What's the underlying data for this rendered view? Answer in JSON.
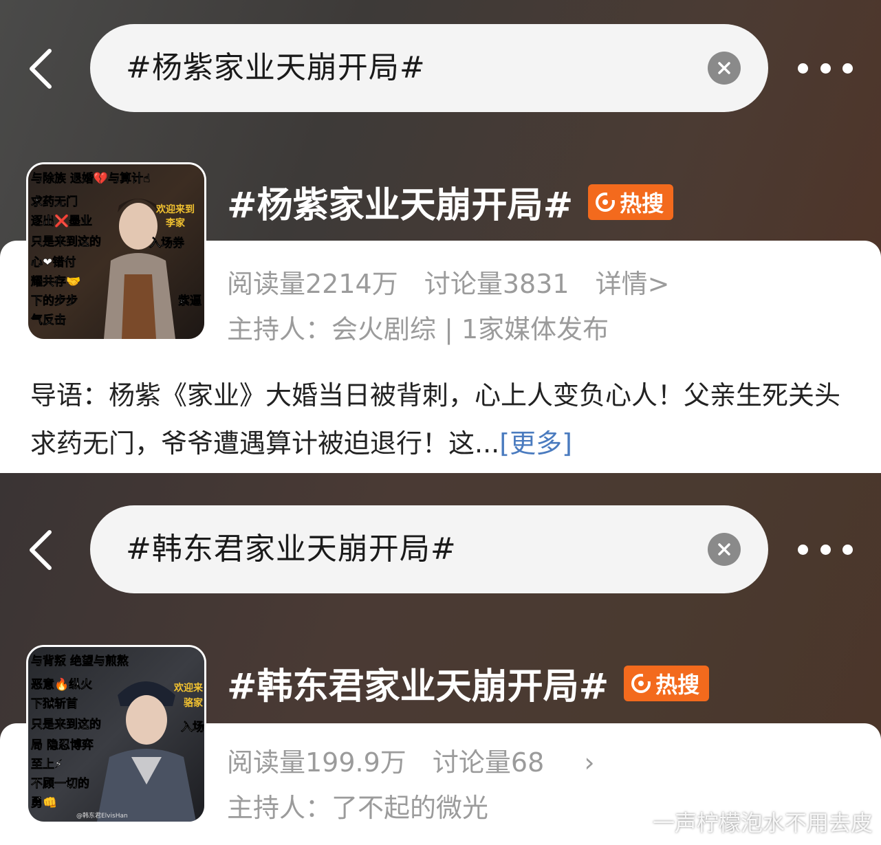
{
  "panel1": {
    "search_text": "#杨紫家业天崩开局#",
    "topic_title": "#杨紫家业天崩开局#",
    "badge": "热搜",
    "reads": "阅读量2214万",
    "discussions": "讨论量3831",
    "detail": "详情>",
    "host": "主持人：会火剧综 | 1家媒体发布",
    "lead_text": "导语：杨紫《家业》大婚当日被背刺，心上人变负心人！父亲生死关头求药无门，爷爷遭遇算计被迫退行！这...",
    "lead_more": "[更多]",
    "thumb_lines": [
      "与除族  退婚💔与算计☝",
      "求药无门",
      "逐出❌墨业",
      "只是来到这的",
      "心❤错付",
      "耀共存🤝",
      "下的步步",
      "气反击"
    ],
    "thumb_side": [
      "欢迎来到",
      "李家",
      "入场券",
      "紫逼"
    ]
  },
  "panel2": {
    "search_text": "#韩东君家业天崩开局#",
    "topic_title": "#韩东君家业天崩开局#",
    "badge": "热搜",
    "reads": "阅读量199.9万",
    "discussions": "讨论量68",
    "chevron": "›",
    "host": "主持人：了不起的微光",
    "thumb_lines": [
      "与背叛  绝望与煎熬",
      "恶意🔥纵火",
      "下狱斩首",
      "只是来到这的",
      "局 隐忍博弈",
      "至上⚡",
      "不顾一切的",
      "勇👊"
    ],
    "thumb_side": [
      "欢迎来",
      "骆家",
      "入场"
    ],
    "thumb_credit": "@韩东君ElvisHan"
  },
  "watermark": "一声柠檬泡水不用去皮"
}
